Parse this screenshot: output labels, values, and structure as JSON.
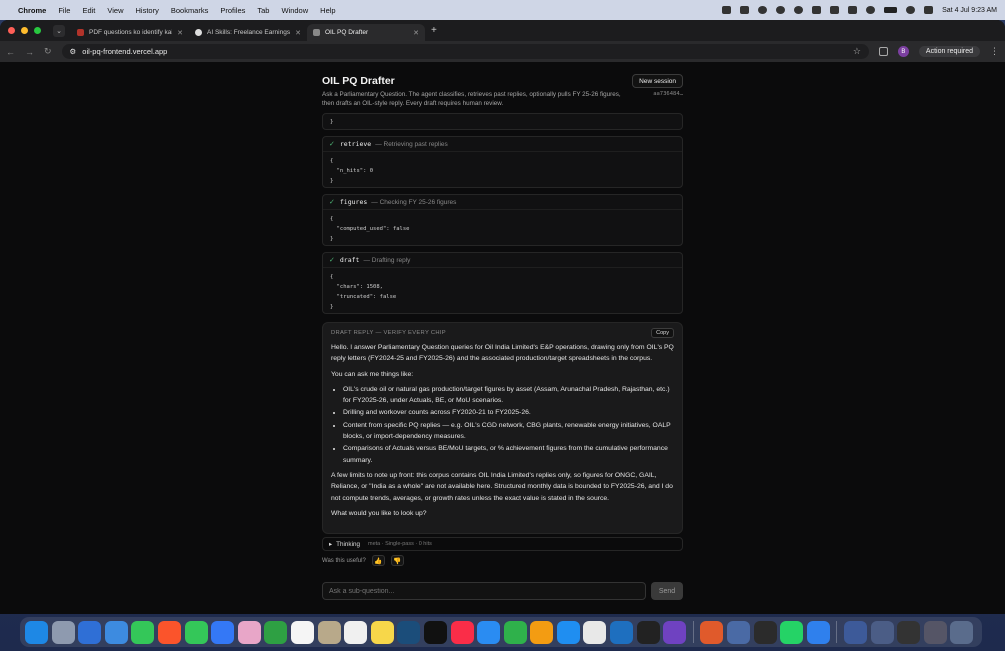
{
  "menubar": {
    "app": "Chrome",
    "items": [
      "File",
      "Edit",
      "View",
      "History",
      "Bookmarks",
      "Profiles",
      "Tab",
      "Window",
      "Help"
    ],
    "ask_gemini": "Ask Gemini",
    "clock": "Sat 4 Jul  9:23 AM"
  },
  "browser": {
    "tabs": [
      {
        "title": "PDF questions ko identify kai",
        "favicon": "red"
      },
      {
        "title": "AI Skills: Freelance Earnings",
        "favicon": "gh"
      },
      {
        "title": "OIL PQ Drafter",
        "favicon": "globe",
        "active": true
      }
    ],
    "url": "oil-pq-frontend.vercel.app",
    "profile_initial": "B",
    "action_required": "Action required"
  },
  "app": {
    "title": "OIL PQ Drafter",
    "description": "Ask a Parliamentary Question. The agent classifies, retrieves past replies, optionally pulls FY 25-26 figures, then drafts an OIL-style reply. Every draft requires human review.",
    "new_session": "New session",
    "session_id": "aa736484…",
    "top_fragment": "}",
    "steps": [
      {
        "name": "retrieve",
        "desc": "— Retrieving past replies",
        "body": "{\n  \"n_hits\": 0\n}"
      },
      {
        "name": "figures",
        "desc": "— Checking FY 25-26 figures",
        "body": "{\n  \"computed_used\": false\n}"
      },
      {
        "name": "draft",
        "desc": "— Drafting reply",
        "body": "{\n  \"chars\": 1508,\n  \"truncated\": false\n}"
      }
    ],
    "draft": {
      "label": "DRAFT REPLY — VERIFY EVERY CHIP",
      "copy": "Copy",
      "intro": "Hello. I answer Parliamentary Question queries for Oil India Limited's E&P operations, drawing only from OIL's PQ reply letters (FY2024-25 and FY2025-26) and the associated production/target spreadsheets in the corpus.",
      "ask_intro": "You can ask me things like:",
      "bullets": [
        "OIL's crude oil or natural gas production/target figures by asset (Assam, Arunachal Pradesh, Rajasthan, etc.) for FY2025-26, under Actuals, BE, or MoU scenarios.",
        "Drilling and workover counts across FY2020-21 to FY2025-26.",
        "Content from specific PQ replies — e.g. OIL's CGD network, CBG plants, renewable energy initiatives, OALP blocks, or import-dependency measures.",
        "Comparisons of Actuals versus BE/MoU targets, or % achievement figures from the cumulative performance summary."
      ],
      "limits": "A few limits to note up front: this corpus contains OIL India Limited's replies only, so figures for ONGC, GAIL, Reliance, or \"India as a whole\" are not available here. Structured monthly data is bounded to FY2025-26, and I do not compute trends, averages, or growth rates unless the exact value is stated in the source.",
      "closing": "What would you like to look up?"
    },
    "thinking": {
      "label": "Thinking",
      "meta": "meta · Single-pass · 0 hits"
    },
    "useful_label": "Was this useful?",
    "ask_placeholder": "Ask a sub-question...",
    "send": "Send"
  },
  "colors": {
    "accent_check": "#4caf72",
    "send_disabled": "#3a3a3a"
  }
}
